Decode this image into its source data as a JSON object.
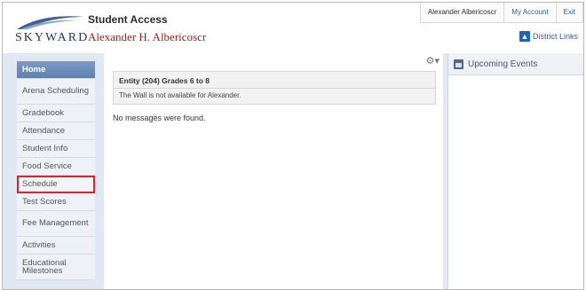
{
  "header": {
    "logo_text": "SKYWARD",
    "title": "Student Access",
    "student_name": "Alexander H. Albericoscr",
    "user": "Alexander Albericoscr",
    "my_account": "My Account",
    "exit": "Exit",
    "district_links": "District Links"
  },
  "sidebar": {
    "items": [
      {
        "label": "Home"
      },
      {
        "label": "Arena Scheduling"
      },
      {
        "label": "Gradebook"
      },
      {
        "label": "Attendance"
      },
      {
        "label": "Student Info"
      },
      {
        "label": "Food Service"
      },
      {
        "label": "Schedule"
      },
      {
        "label": "Test Scores"
      },
      {
        "label": "Fee Management"
      },
      {
        "label": "Activities"
      },
      {
        "label": "Educational Milestones"
      }
    ]
  },
  "main": {
    "entity_title": "Entity (204) Grades 6 to 8",
    "entity_msg": "The Wall is not available for Alexander.",
    "no_messages": "No messages were found."
  },
  "right_panel": {
    "events_title": "Upcoming Events"
  },
  "colors": {
    "accent": "#5d7fb2",
    "highlight": "#d8242a",
    "name_red": "#9a1f1f"
  }
}
